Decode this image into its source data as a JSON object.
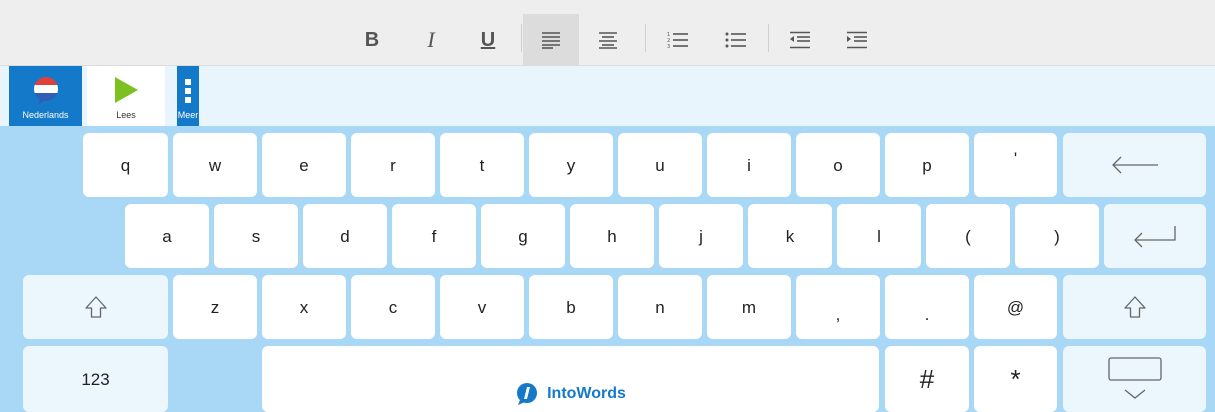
{
  "toolbar": {
    "buttons": [
      {
        "name": "bold-button",
        "glyph": "B"
      },
      {
        "name": "italic-button",
        "glyph": "I"
      },
      {
        "name": "underline-button",
        "glyph": "U"
      }
    ],
    "active": "align-left-button",
    "icons": [
      "align-left-icon",
      "align-center-icon",
      "numbered-list-icon",
      "bullet-list-icon",
      "outdent-icon",
      "indent-icon"
    ]
  },
  "appbar": {
    "language_label": "Nederlands",
    "read_label": "Lees",
    "more_label": "Meer"
  },
  "keyboard": {
    "row1": [
      "q",
      "w",
      "e",
      "r",
      "t",
      "y",
      "u",
      "i",
      "o",
      "p",
      "'"
    ],
    "row2": [
      "a",
      "s",
      "d",
      "f",
      "g",
      "h",
      "j",
      "k",
      "l",
      "(",
      ")"
    ],
    "row3": [
      "z",
      "x",
      "c",
      "v",
      "b",
      "n",
      "m",
      ",",
      ".",
      "@"
    ],
    "numbers_label": "123",
    "brand_name": "IntoWords",
    "hash": "#",
    "asterisk": "*"
  },
  "colors": {
    "background": "#a8d8f5",
    "accent": "#1479c8",
    "read_icon": "#7cc022",
    "key": "#ffffff",
    "special_key": "#ecf6fd"
  }
}
